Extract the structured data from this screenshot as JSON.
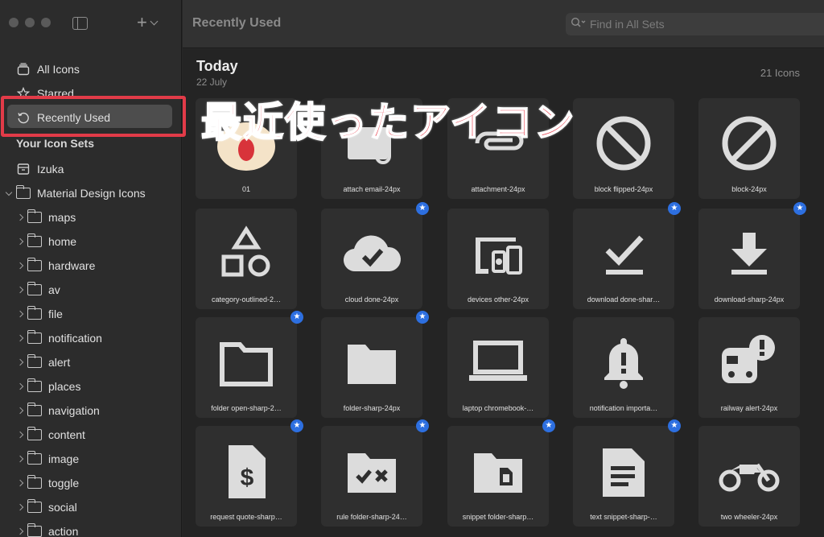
{
  "window": {
    "title": "Recently Used"
  },
  "sidebar": {
    "top_items": [
      {
        "label": "All Icons",
        "icon": "all-icons-icon"
      },
      {
        "label": "Starred",
        "icon": "star-icon"
      },
      {
        "label": "Recently Used",
        "icon": "recent-icon",
        "selected": true
      }
    ],
    "section_title": "Your Icon Sets",
    "sets": [
      {
        "label": "Izuka",
        "icon": "tray-icon"
      },
      {
        "label": "Material Design Icons",
        "icon": "folder-icon",
        "expanded": true
      }
    ],
    "folders": [
      "maps",
      "home",
      "hardware",
      "av",
      "file",
      "notification",
      "alert",
      "places",
      "navigation",
      "content",
      "image",
      "toggle",
      "social",
      "action"
    ]
  },
  "search": {
    "placeholder": "Find in All Sets"
  },
  "main": {
    "section_title": "Today",
    "section_date": "22 July",
    "icon_count": "21 Icons",
    "overlay_caption": "最近使ったアイコン",
    "icons": [
      {
        "label": "01",
        "glyph": "sticker-image",
        "starred": false
      },
      {
        "label": "attach email-24px",
        "glyph": "attach-email-icon",
        "starred": false
      },
      {
        "label": "attachment-24px",
        "glyph": "attachment-icon",
        "starred": false
      },
      {
        "label": "block flipped-24px",
        "glyph": "block-flipped-icon",
        "starred": false
      },
      {
        "label": "block-24px",
        "glyph": "block-icon",
        "starred": false
      },
      {
        "label": "category-outlined-2…",
        "glyph": "category-icon",
        "starred": false
      },
      {
        "label": "cloud done-24px",
        "glyph": "cloud-done-icon",
        "starred": true
      },
      {
        "label": "devices other-24px",
        "glyph": "devices-other-icon",
        "starred": false
      },
      {
        "label": "download done-shar…",
        "glyph": "download-done-icon",
        "starred": true
      },
      {
        "label": "download-sharp-24px",
        "glyph": "download-icon",
        "starred": true
      },
      {
        "label": "folder open-sharp-2…",
        "glyph": "folder-open-icon",
        "starred": true
      },
      {
        "label": "folder-sharp-24px",
        "glyph": "folder-icon",
        "starred": true
      },
      {
        "label": "laptop chromebook-…",
        "glyph": "laptop-icon",
        "starred": false
      },
      {
        "label": "notification importa…",
        "glyph": "notification-important-icon",
        "starred": false
      },
      {
        "label": "railway alert-24px",
        "glyph": "railway-alert-icon",
        "starred": false
      },
      {
        "label": "request quote-sharp…",
        "glyph": "request-quote-icon",
        "starred": true
      },
      {
        "label": "rule folder-sharp-24…",
        "glyph": "rule-folder-icon",
        "starred": true
      },
      {
        "label": "snippet folder-sharp…",
        "glyph": "snippet-folder-icon",
        "starred": true
      },
      {
        "label": "text snippet-sharp-…",
        "glyph": "text-snippet-icon",
        "starred": true
      },
      {
        "label": "two wheeler-24px",
        "glyph": "two-wheeler-icon",
        "starred": false
      }
    ]
  },
  "colors": {
    "accent_star": "#2d6fe0",
    "highlight": "#e23b48",
    "caption": "#e94755"
  }
}
